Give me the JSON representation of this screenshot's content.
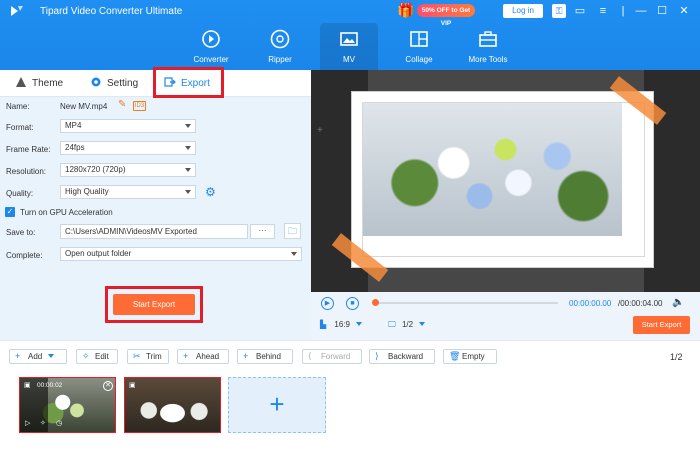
{
  "app": {
    "title": "Tipard Video Converter Ultimate",
    "promo_text": "50% OFF to Get VIP",
    "login_label": "Log in",
    "window_icons": [
      "key-icon",
      "chat-icon",
      "menu-icon",
      "minimize-icon",
      "maximize-icon",
      "close-icon"
    ]
  },
  "nav": {
    "items": [
      {
        "label": "Converter",
        "icon": "converter-icon"
      },
      {
        "label": "Ripper",
        "icon": "ripper-icon"
      },
      {
        "label": "MV",
        "icon": "mv-icon",
        "active": true
      },
      {
        "label": "Collage",
        "icon": "collage-icon"
      },
      {
        "label": "More Tools",
        "icon": "toolbox-icon"
      }
    ]
  },
  "subtabs": {
    "theme": "Theme",
    "setting": "Setting",
    "export": "Export"
  },
  "export_form": {
    "name_label": "Name:",
    "name_value": "New MV.mp4",
    "id3_label": "ID3",
    "format_label": "Format:",
    "format_value": "MP4",
    "frame_rate_label": "Frame Rate:",
    "frame_rate_value": "24fps",
    "resolution_label": "Resolution:",
    "resolution_value": "1280x720 (720p)",
    "quality_label": "Quality:",
    "quality_value": "High Quality",
    "gpu_label": "Turn on GPU Acceleration",
    "gpu_checked": true,
    "save_to_label": "Save to:",
    "save_to_value": "C:\\Users\\ADMIN\\VideosMV Exported",
    "browse_label": "···",
    "complete_label": "Complete:",
    "complete_value": "Open output folder",
    "start_export_label": "Start Export"
  },
  "player": {
    "time_current": "00:00:00.00",
    "time_total": "/00:00:04.00",
    "progress": 0.0,
    "aspect_ratio": "16:9",
    "page": "1/2",
    "start_export_label": "Start Export"
  },
  "toolbar": {
    "add": "Add",
    "edit": "Edit",
    "trim": "Trim",
    "ahead": "Ahead",
    "behind": "Behind",
    "forward": "Forward",
    "backward": "Backward",
    "empty": "Empty",
    "page_count": "1/2"
  },
  "clips": {
    "items": [
      {
        "time": "00:00:02",
        "selected": true
      },
      {
        "time": "",
        "selected": true
      }
    ],
    "add_symbol": "+"
  },
  "colors": {
    "accent": "#1f86ea",
    "export_orange": "#ff6b35",
    "highlight_red": "#e31d2a"
  }
}
